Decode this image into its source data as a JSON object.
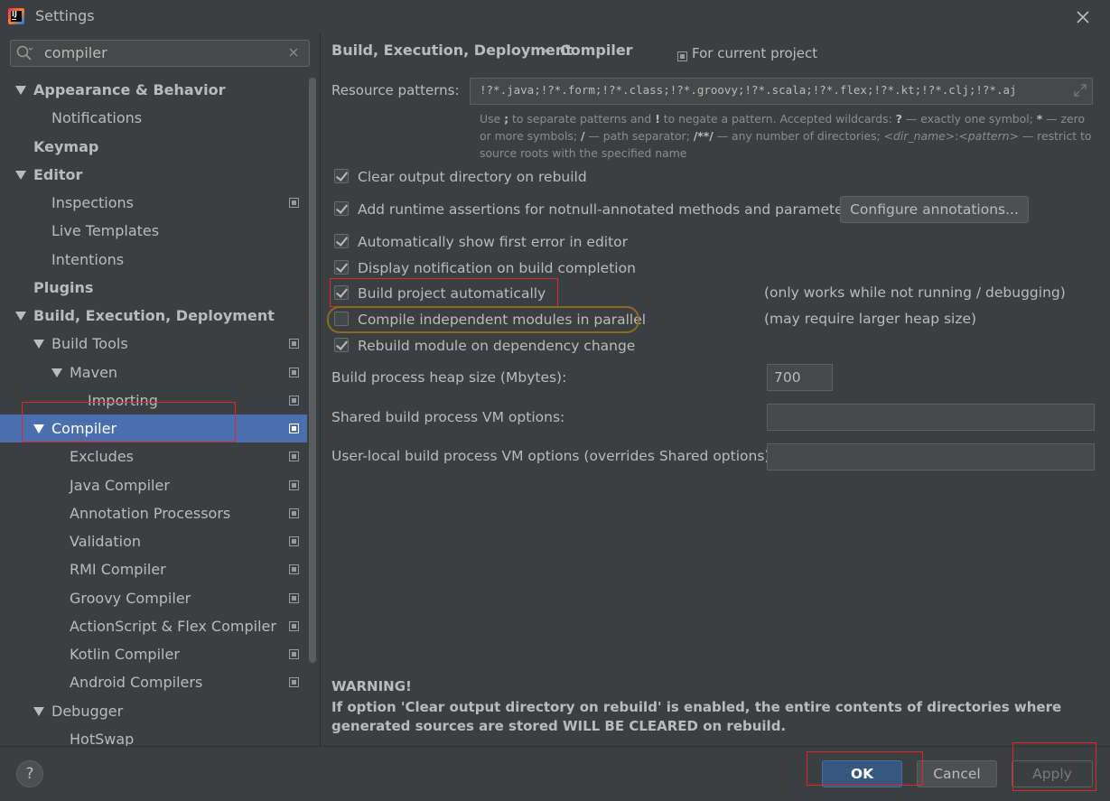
{
  "window": {
    "title": "Settings"
  },
  "search": {
    "value": "compiler"
  },
  "tree": [
    {
      "label": "Appearance & Behavior",
      "bold": true,
      "arrow": true,
      "level": 0,
      "project": false
    },
    {
      "label": "Notifications",
      "bold": false,
      "arrow": false,
      "level": 1,
      "project": false
    },
    {
      "label": "Keymap",
      "bold": true,
      "arrow": false,
      "level": 0,
      "project": false
    },
    {
      "label": "Editor",
      "bold": true,
      "arrow": true,
      "level": 0,
      "project": false
    },
    {
      "label": "Inspections",
      "bold": false,
      "arrow": false,
      "level": 1,
      "project": true
    },
    {
      "label": "Live Templates",
      "bold": false,
      "arrow": false,
      "level": 1,
      "project": false
    },
    {
      "label": "Intentions",
      "bold": false,
      "arrow": false,
      "level": 1,
      "project": false
    },
    {
      "label": "Plugins",
      "bold": true,
      "arrow": false,
      "level": 0,
      "project": false
    },
    {
      "label": "Build, Execution, Deployment",
      "bold": true,
      "arrow": true,
      "level": 0,
      "project": false
    },
    {
      "label": "Build Tools",
      "bold": false,
      "arrow": true,
      "level": 1,
      "project": true
    },
    {
      "label": "Maven",
      "bold": false,
      "arrow": true,
      "level": 2,
      "project": true
    },
    {
      "label": "Importing",
      "bold": false,
      "arrow": false,
      "level": 3,
      "project": true
    },
    {
      "label": "Compiler",
      "bold": false,
      "arrow": true,
      "level": 1,
      "project": true,
      "selected": true
    },
    {
      "label": "Excludes",
      "bold": false,
      "arrow": false,
      "level": 2,
      "project": true
    },
    {
      "label": "Java Compiler",
      "bold": false,
      "arrow": false,
      "level": 2,
      "project": true
    },
    {
      "label": "Annotation Processors",
      "bold": false,
      "arrow": false,
      "level": 2,
      "project": true
    },
    {
      "label": "Validation",
      "bold": false,
      "arrow": false,
      "level": 2,
      "project": true
    },
    {
      "label": "RMI Compiler",
      "bold": false,
      "arrow": false,
      "level": 2,
      "project": true
    },
    {
      "label": "Groovy Compiler",
      "bold": false,
      "arrow": false,
      "level": 2,
      "project": true
    },
    {
      "label": "ActionScript & Flex Compiler",
      "bold": false,
      "arrow": false,
      "level": 2,
      "project": true
    },
    {
      "label": "Kotlin Compiler",
      "bold": false,
      "arrow": false,
      "level": 2,
      "project": true
    },
    {
      "label": "Android Compilers",
      "bold": false,
      "arrow": false,
      "level": 2,
      "project": true
    },
    {
      "label": "Debugger",
      "bold": false,
      "arrow": true,
      "level": 1,
      "project": false
    },
    {
      "label": "HotSwap",
      "bold": false,
      "arrow": false,
      "level": 2,
      "project": false
    }
  ],
  "breadcrumb": {
    "parent": "Build, Execution, Deployment",
    "separator": "›",
    "current": "Compiler",
    "scope": "For current project"
  },
  "resource_patterns": {
    "label": "Resource patterns:",
    "value": "!?*.java;!?*.form;!?*.class;!?*.groovy;!?*.scala;!?*.flex;!?*.kt;!?*.clj;!?*.aj",
    "hint": {
      "p1": "Use ",
      "b1": ";",
      "p2": " to separate patterns and ",
      "b2": "!",
      "p3": " to negate a pattern. Accepted wildcards: ",
      "b3": "?",
      "p4": " — exactly one symbol; ",
      "b4": "*",
      "p5": " — zero or more symbols; ",
      "b5": "/",
      "p6": " — path separator; ",
      "b6": "/**/",
      "p7": " — any number of directories; ",
      "i1": "<dir_name>",
      "p8": ":",
      "i2": "<pattern>",
      "p9": " — restrict to source roots with the specified name"
    }
  },
  "checkboxes": [
    {
      "label": "Clear output directory on rebuild",
      "checked": true
    },
    {
      "label": "Add runtime assertions for notnull-annotated methods and parameters",
      "checked": true
    },
    {
      "label": "Automatically show first error in editor",
      "checked": true
    },
    {
      "label": "Display notification on build completion",
      "checked": true
    },
    {
      "label": "Build project automatically",
      "checked": true
    },
    {
      "label": "Compile independent modules in parallel",
      "checked": false
    },
    {
      "label": "Rebuild module on dependency change",
      "checked": true
    }
  ],
  "notes": {
    "build_auto": "(only works while not running / debugging)",
    "parallel": "(may require larger heap size)"
  },
  "configure_annotations_label": "Configure annotations...",
  "heap": {
    "label": "Build process heap size (Mbytes):",
    "value": "700"
  },
  "shared_vm": {
    "label": "Shared build process VM options:",
    "value": ""
  },
  "user_vm": {
    "label": "User-local build process VM options (overrides Shared options):",
    "value": ""
  },
  "warning": {
    "title": "WARNING!",
    "text": "If option 'Clear output directory on rebuild' is enabled, the entire contents of directories where generated sources are stored WILL BE CLEARED on rebuild."
  },
  "buttons": {
    "help": "?",
    "ok": "OK",
    "cancel": "Cancel",
    "apply": "Apply"
  },
  "colors": {
    "background": "#3c3f41",
    "selection": "#4b6eaf",
    "accent_button": "#365880",
    "annotation_red": "#e0262c",
    "annotation_orange": "#8a6b22"
  }
}
